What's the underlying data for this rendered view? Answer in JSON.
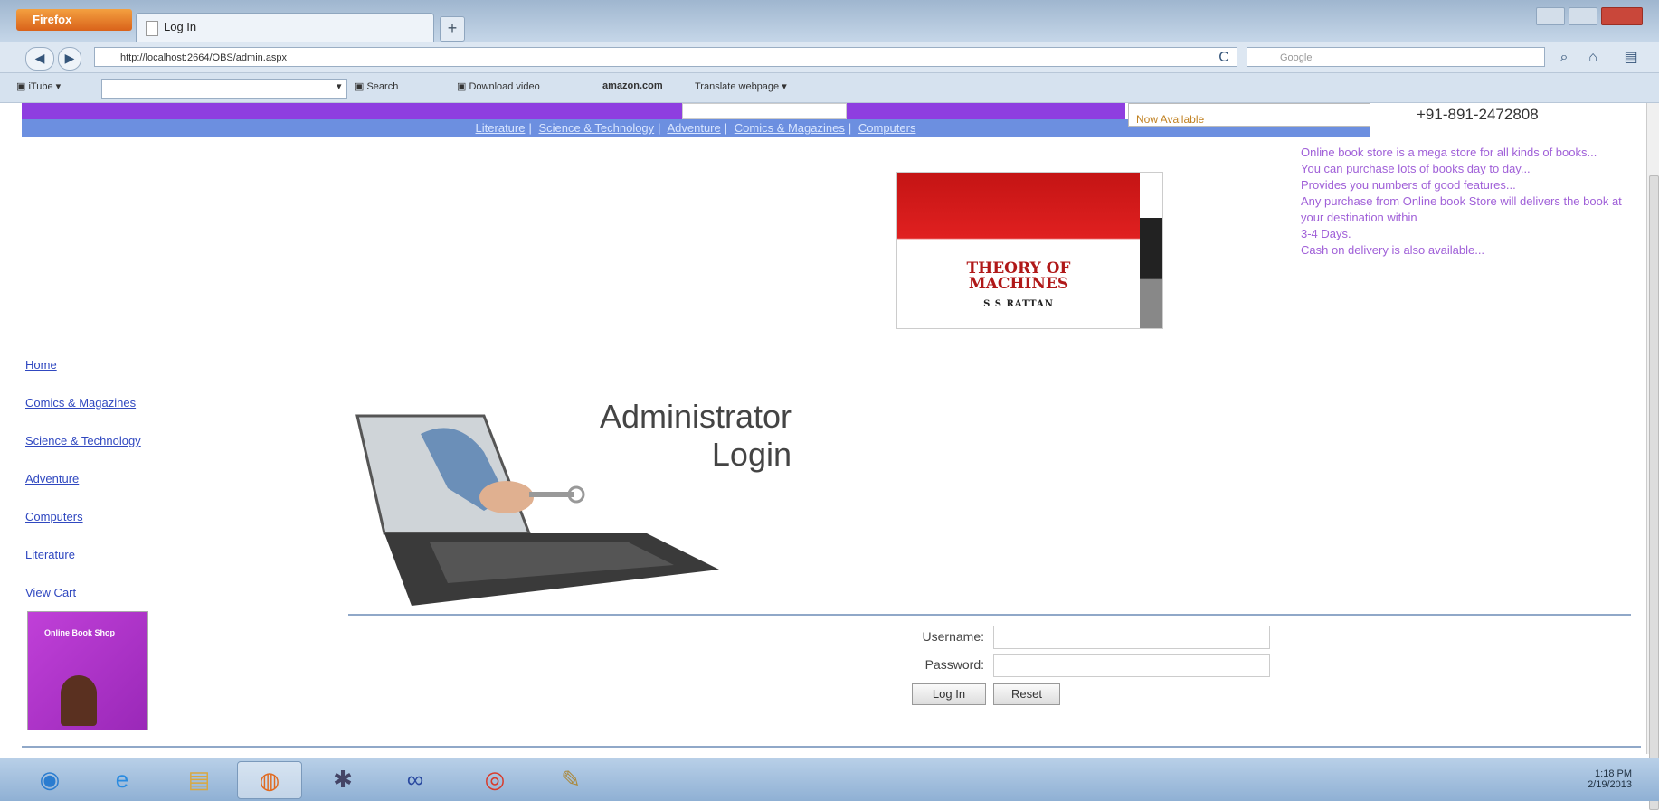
{
  "browser": {
    "app_button": "Firefox",
    "tab_title": "Log In",
    "new_tab": "+",
    "url": "http://localhost:2664/OBS/admin.aspx",
    "search_placeholder": "Google",
    "back": "◀",
    "forward": "▶",
    "reload": "C",
    "home_icon": "home-icon",
    "bookmarks_bar": {
      "toolbar_label": "iTube",
      "search_label": "Search",
      "download_label": "Download video",
      "amazon_label": "amazon.com",
      "translate_label": "Translate webpage"
    }
  },
  "site": {
    "availability_text": "Now Available",
    "phone": "+91-891-2472808",
    "top_links": [
      "Literature",
      "Science & Technology",
      "Adventure",
      "Comics & Magazines",
      "Computers"
    ],
    "ad": {
      "title_line1": "THEORY OF",
      "title_line2": "MACHINES",
      "author": "S S RATTAN"
    },
    "description": [
      "Online book store is a mega store for all kinds of books...",
      "You can purchase lots of books day to day...",
      "Provides you numbers of good features...",
      "Any purchase from Online book Store will delivers the book at your destination within",
      "3-4 Days.",
      "Cash on delivery is also available..."
    ],
    "sidenav": [
      "Home",
      "Comics & Magazines",
      "Science & Technology",
      "Adventure",
      "Computers",
      "Literature",
      "View Cart"
    ],
    "promo_label": "Online Book Shop",
    "admin_title_line1": "Administrator",
    "admin_title_line2": "Login",
    "form": {
      "username_label": "Username:",
      "password_label": "Password:",
      "username_value": "",
      "password_value": "",
      "login_button": "Log In",
      "reset_button": "Reset"
    }
  },
  "taskbar": {
    "items": [
      "start-orb",
      "ie-icon",
      "explorer-icon",
      "firefox-icon",
      "network-icon",
      "infinity-icon",
      "chrome-icon",
      "tool-icon"
    ],
    "clock_time": "1:18 PM",
    "clock_date": "2/19/2013"
  }
}
